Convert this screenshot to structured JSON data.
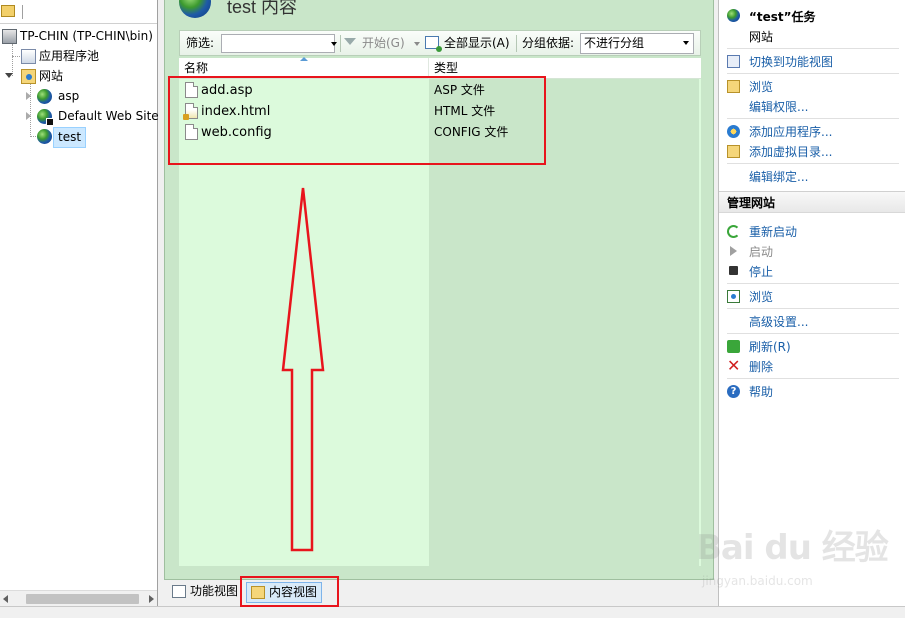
{
  "tree": {
    "nodes": [
      {
        "id": "server",
        "label": "TP-CHIN (TP-CHIN\\bin)"
      },
      {
        "id": "app-pools",
        "label": "应用程序池"
      },
      {
        "id": "sites",
        "label": "网站"
      },
      {
        "id": "site-asp",
        "label": "asp"
      },
      {
        "id": "site-default",
        "label": "Default Web Site"
      },
      {
        "id": "site-test",
        "label": "test",
        "selected": true
      }
    ]
  },
  "center": {
    "title": "test 内容",
    "filter_bar": {
      "filter_label": "筛选:",
      "filter_value": "",
      "start_label": "开始(G)",
      "show_all_label": "全部显示(A)",
      "group_by_label": "分组依据:",
      "group_by_value": "不进行分组"
    },
    "columns": {
      "name": "名称",
      "type": "类型"
    },
    "files": [
      {
        "name": "add.asp",
        "type": "ASP 文件",
        "icon": "generic-file-icon"
      },
      {
        "name": "index.html",
        "type": "HTML 文件",
        "icon": "html-file-icon"
      },
      {
        "name": "web.config",
        "type": "CONFIG 文件",
        "icon": "generic-file-icon"
      }
    ]
  },
  "view_tabs": {
    "features_view": "功能视图",
    "content_view": "内容视图",
    "active": "content_view"
  },
  "actions": {
    "header_title": "“test”任务",
    "header_sub": "网站",
    "switch_to_features": "切换到功能视图",
    "browse": "浏览",
    "edit_permissions": "编辑权限...",
    "add_application": "添加应用程序...",
    "add_virtual_directory": "添加虚拟目录...",
    "edit_bindings": "编辑绑定...",
    "manage_site_header": "管理网站",
    "restart": "重新启动",
    "start": "启动",
    "stop": "停止",
    "browse2": "浏览",
    "advanced_settings": "高级设置...",
    "refresh": "刷新(R)",
    "delete": "删除",
    "help": "帮助"
  },
  "watermark": {
    "main": "Bai du 经验",
    "url": "jingyan.baidu.com"
  },
  "colors": {
    "annotation_red": "#e8141c",
    "content_bg": "#dcfadc",
    "pane_green": "#c9e6c9",
    "link_blue": "#1a5fa8"
  }
}
